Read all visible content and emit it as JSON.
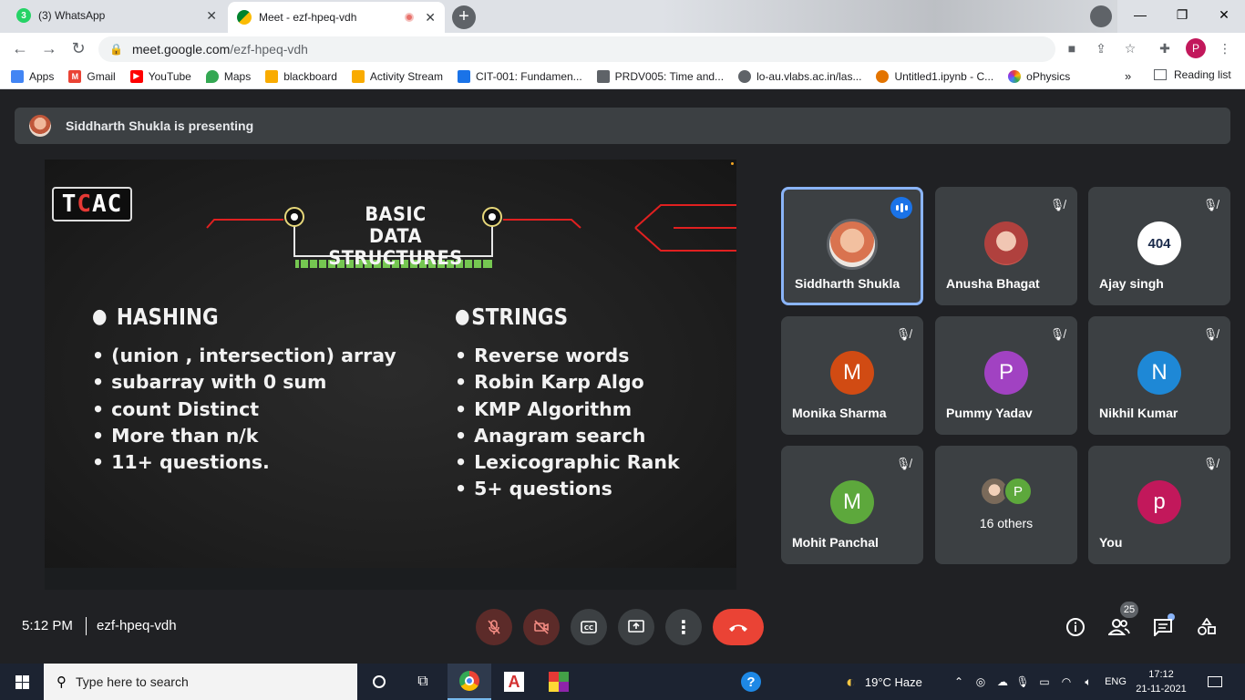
{
  "browser": {
    "tabs": [
      {
        "title": "(3) WhatsApp",
        "favicon": "whatsapp-icon",
        "badge": "3",
        "active": false
      },
      {
        "title": "Meet - ezf-hpeq-vdh",
        "favicon": "meet-icon",
        "active": true
      }
    ],
    "address": {
      "domain": "meet.google.com",
      "path": "/ezf-hpeq-vdh"
    },
    "profile_initial": "P",
    "bookmarks": [
      {
        "label": "Apps",
        "icon": "apps-grid-icon",
        "color": "#4285f4"
      },
      {
        "label": "Gmail",
        "icon": "gmail-icon",
        "color": "#ea4335"
      },
      {
        "label": "YouTube",
        "icon": "youtube-icon",
        "color": "#ff0000"
      },
      {
        "label": "Maps",
        "icon": "maps-pin-icon",
        "color": "#34a853"
      },
      {
        "label": "blackboard",
        "icon": "bookmark-yellow-icon",
        "color": "#f9ab00"
      },
      {
        "label": "Activity Stream",
        "icon": "bookmark-yellow-icon",
        "color": "#f9ab00"
      },
      {
        "label": "CIT-001: Fundamen...",
        "icon": "course-icon",
        "color": "#1a73e8"
      },
      {
        "label": "PRDV005: Time and...",
        "icon": "course-icon",
        "color": "#5f6368"
      },
      {
        "label": "lo-au.vlabs.ac.in/las...",
        "icon": "globe-icon",
        "color": "#5f6368"
      },
      {
        "label": "Untitled1.ipynb - C...",
        "icon": "colab-icon",
        "color": "#e37400"
      },
      {
        "label": "oPhysics",
        "icon": "ophysics-icon",
        "color": "#9334e6"
      }
    ],
    "more_label": "»",
    "reading_list": "Reading list"
  },
  "meet": {
    "presenting_text": "Siddharth Shukla is presenting",
    "slide": {
      "logo": {
        "t": "T",
        "c": "C",
        "ac": "AC"
      },
      "title_line1": "BASIC",
      "title_line2": "DATA STRUCTURES",
      "left": {
        "header": "HASHING",
        "items": [
          "(union , intersection) array",
          "subarray with 0 sum",
          "count Distinct",
          "More than n/k",
          "11+ questions."
        ]
      },
      "right": {
        "header": "STRINGS",
        "items": [
          "Reverse words",
          "Robin Karp Algo",
          "KMP Algorithm",
          "Anagram search",
          "Lexicographic Rank",
          "5+ questions"
        ]
      }
    },
    "participants": [
      {
        "name": "Siddharth Shukla",
        "initial": "",
        "color": "#d9734f",
        "speaking": true
      },
      {
        "name": "Anusha Bhagat",
        "initial": "",
        "color": "#b0413e",
        "speaking": false
      },
      {
        "name": "Ajay singh",
        "initial": "404",
        "color": "#ffffff",
        "speaking": false
      },
      {
        "name": "Monika Sharma",
        "initial": "M",
        "color": "#d14b13",
        "speaking": false
      },
      {
        "name": "Pummy Yadav",
        "initial": "P",
        "color": "#a142c2",
        "speaking": false
      },
      {
        "name": "Nikhil Kumar",
        "initial": "N",
        "color": "#1e88d6",
        "speaking": false
      },
      {
        "name": "Mohit Panchal",
        "initial": "M",
        "color": "#5da83c",
        "speaking": false
      },
      {
        "name": "16 others",
        "initial": "P",
        "color": "#5da83c",
        "speaking": false
      },
      {
        "name": "You",
        "initial": "p",
        "color": "#c2185b",
        "speaking": false
      }
    ],
    "time": "5:12 PM",
    "meeting_code": "ezf-hpeq-vdh",
    "people_count": "25"
  },
  "taskbar": {
    "search_placeholder": "Type here to search",
    "weather": "19°C  Haze",
    "language": "ENG",
    "time": "17:12",
    "date": "21-11-2021"
  }
}
